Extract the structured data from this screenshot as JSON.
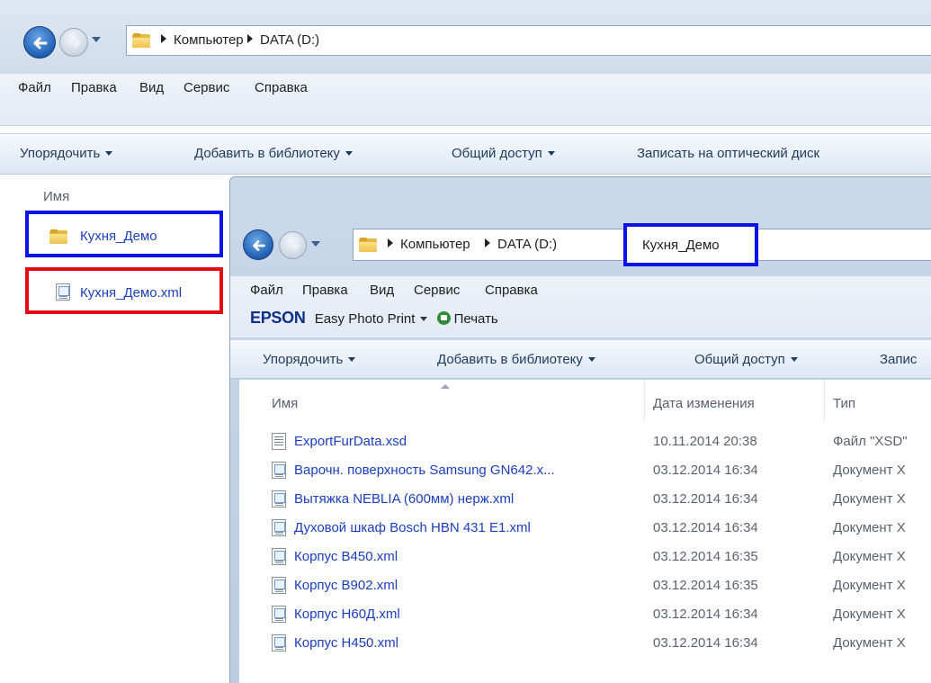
{
  "outer": {
    "breadcrumb": [
      "Компьютер",
      "DATA (D:)"
    ],
    "menu": [
      "Файл",
      "Правка",
      "Вид",
      "Сервис",
      "Справка"
    ],
    "toolbar": [
      "Упорядочить",
      "Добавить в библиотеку",
      "Общий доступ",
      "Записать на оптический диск"
    ],
    "column_name": "Имя",
    "items": [
      {
        "label": "Кухня_Демо",
        "icon": "folder-icon",
        "highlight": "blue"
      },
      {
        "label": "Кухня_Демо.xml",
        "icon": "xml-file-icon",
        "highlight": "red"
      }
    ]
  },
  "inner": {
    "breadcrumb": [
      "Компьютер",
      "DATA (D:)",
      "Кухня_Демо"
    ],
    "menu": [
      "Файл",
      "Правка",
      "Вид",
      "Сервис",
      "Справка"
    ],
    "epson": {
      "brand": "EPSON",
      "app": "Easy Photo Print",
      "print": "Печать"
    },
    "toolbar": [
      "Упорядочить",
      "Добавить в библиотеку",
      "Общий доступ",
      "Запис"
    ],
    "columns": {
      "name": "Имя",
      "date": "Дата изменения",
      "type": "Тип"
    },
    "files": [
      {
        "name": "ExportFurData.xsd",
        "date": "10.11.2014 20:38",
        "type": "Файл \"XSD\"",
        "icon": "xsd-file-icon"
      },
      {
        "name": "Варочн. поверхность Samsung GN642.x...",
        "date": "03.12.2014 16:34",
        "type": "Документ X",
        "icon": "xml-file-icon"
      },
      {
        "name": "Вытяжка NEBLIA (600мм) нерж.xml",
        "date": "03.12.2014 16:34",
        "type": "Документ X",
        "icon": "xml-file-icon"
      },
      {
        "name": "Духовой шкаф Bosch HBN 431 E1.xml",
        "date": "03.12.2014 16:34",
        "type": "Документ X",
        "icon": "xml-file-icon"
      },
      {
        "name": "Корпус В450.xml",
        "date": "03.12.2014 16:35",
        "type": "Документ X",
        "icon": "xml-file-icon"
      },
      {
        "name": "Корпус В902.xml",
        "date": "03.12.2014 16:35",
        "type": "Документ X",
        "icon": "xml-file-icon"
      },
      {
        "name": "Корпус Н60Д.xml",
        "date": "03.12.2014 16:34",
        "type": "Документ X",
        "icon": "xml-file-icon"
      },
      {
        "name": "Корпус Н450.xml",
        "date": "03.12.2014 16:34",
        "type": "Документ X",
        "icon": "xml-file-icon"
      }
    ]
  }
}
